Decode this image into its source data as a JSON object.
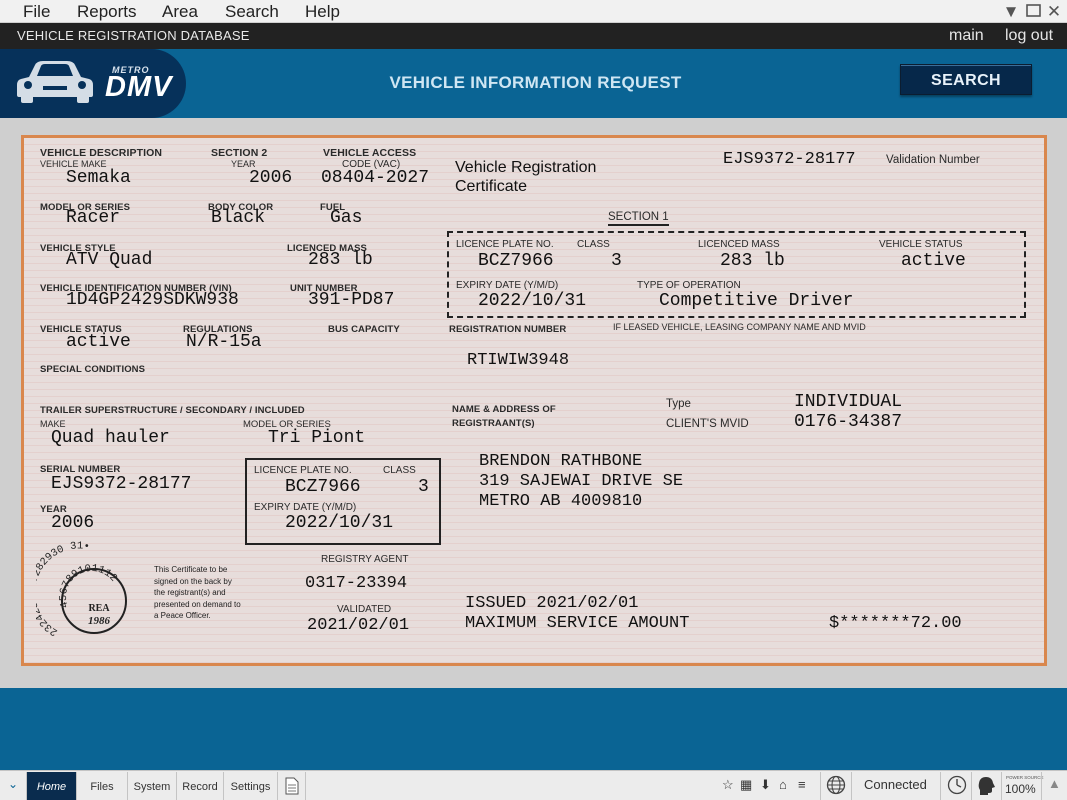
{
  "menu": {
    "file": "File",
    "reports": "Reports",
    "area": "Area",
    "search": "Search",
    "help": "Help"
  },
  "titlebar": {
    "title": "VEHICLE REGISTRATION DATABASE",
    "main": "main",
    "logout": "log out"
  },
  "header": {
    "logo_small": "METRO",
    "logo_big": "DMV",
    "title": "VEHICLE INFORMATION REQUEST",
    "search": "SEARCH"
  },
  "cert": {
    "vd_label": "VEHICLE DESCRIPTION",
    "make_label": "VEHICLE MAKE",
    "make": "Semaka",
    "section2": "SECTION 2",
    "year_label": "YEAR",
    "year": "2006",
    "access_label": "VEHICLE ACCESS",
    "code_label": "CODE (VAC)",
    "code": "08404-2027",
    "reg_cert": "Vehicle Registration",
    "reg_cert2": "Certificate",
    "validation": "EJS9372-28177",
    "validation_label": "Validation Number",
    "model_label": "MODEL OR SERIES",
    "model": "Racer",
    "color_label": "BODY COLOR",
    "color": "Black",
    "fuel_label": "FUEL",
    "fuel": "Gas",
    "section1": "SECTION 1",
    "style_label": "VEHICLE STYLE",
    "style": "ATV Quad",
    "mass_label": "LICENCED MASS",
    "mass": "283 lb",
    "s1_plate_label": "LICENCE PLATE NO.",
    "s1_plate": "BCZ7966",
    "s1_class_label": "CLASS",
    "s1_class": "3",
    "s1_mass_label": "LICENCED MASS",
    "s1_mass": "283 lb",
    "s1_status_label": "VEHICLE STATUS",
    "s1_status": "active",
    "s1_expiry_label": "EXPIRY DATE  (Y/M/D)",
    "s1_expiry": "2022/10/31",
    "s1_type_label": "TYPE OF OPERATION",
    "s1_type": "Competitive Driver",
    "vin_label": "VEHICLE IDENTIFICATION NUMBER (VIN)",
    "vin": "1D4GP2429SDKW938",
    "unit_label": "UNIT NUMBER",
    "unit": "391-PD87",
    "status_label": "VEHICLE STATUS",
    "status": "active",
    "regs_label": "REGULATIONS",
    "regs": "N/R-15a",
    "bus_label": "BUS CAPACITY",
    "regnum_label": "REGISTRATION NUMBER",
    "regnum": "RTIWIW3948",
    "leased_label": "IF LEASED VEHICLE, LEASING COMPANY NAME AND MVID",
    "special_label": "SPECIAL CONDITIONS",
    "trailer_label": "TRAILER SUPERSTRUCTURE / SECONDARY / INCLUDED",
    "t_make_label": "MAKE",
    "t_make": "Quad hauler",
    "t_model_label": "MODEL OR SERIES",
    "t_model": "Tri Piont",
    "name_label": "NAME & ADDRESS OF",
    "name_label2": "REGISTRAANT(S)",
    "type_label": "Type",
    "type": "INDIVIDUAL",
    "mvid_label": "CLIENT'S MVID",
    "mvid": "0176-34387",
    "serial_label": "SERIAL NUMBER",
    "serial": "EJS9372-28177",
    "t_plate_label": "LICENCE PLATE NO.",
    "t_class_label": "CLASS",
    "t_plate": "BCZ7966",
    "t_class": "3",
    "t_expiry_label": "EXPIRY DATE (Y/M/D)",
    "t_expiry": "2022/10/31",
    "t_year_label": "YEAR",
    "t_year": "2006",
    "name": "BRENDON RATHBONE",
    "addr1": "319 SAJEWAI DRIVE SE",
    "addr2": "METRO AB 4009810",
    "agent_label": "REGISTRY AGENT",
    "agent": "0317-23394",
    "validated_label": "VALIDATED",
    "validated": "2021/02/01",
    "issued": "ISSUED 2021/02/01",
    "max": "MAXIMUM SERVICE AMOUNT",
    "amount": "$*******72.00",
    "notice": [
      "This Certificate to be",
      "signed on the back by",
      "the registrant(s) and",
      "presented on demand to",
      "a Peace Officer."
    ],
    "seal_outer": "2324252627282930 31•",
    "seal_inner": "456789101112",
    "seal_rea": "REA",
    "seal_year": "1986"
  },
  "taskbar": {
    "home": "Home",
    "files": "Files",
    "system": "System",
    "record": "Record",
    "settings": "Settings",
    "connected": "Connected",
    "power": "POWER SOURCE",
    "battery": "100%"
  }
}
